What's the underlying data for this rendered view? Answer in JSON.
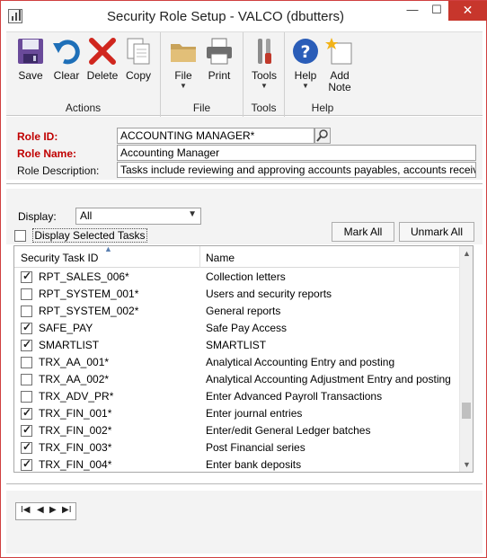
{
  "window": {
    "title": "Security Role Setup  -  VALCO (dbutters)",
    "controls": {
      "minimize": "—",
      "maximize": "☐",
      "close": "✕"
    }
  },
  "ribbon": {
    "groups": [
      {
        "label": "Actions",
        "buttons": [
          {
            "label": "Save",
            "icon": "save-icon"
          },
          {
            "label": "Clear",
            "icon": "clear-icon"
          },
          {
            "label": "Delete",
            "icon": "delete-icon"
          },
          {
            "label": "Copy",
            "icon": "copy-icon"
          }
        ]
      },
      {
        "label": "File",
        "buttons": [
          {
            "label": "File",
            "icon": "folder-icon",
            "dropdown": true
          },
          {
            "label": "Print",
            "icon": "print-icon"
          }
        ]
      },
      {
        "label": "Tools",
        "buttons": [
          {
            "label": "Tools",
            "icon": "tools-icon",
            "dropdown": true
          }
        ]
      },
      {
        "label": "Help",
        "buttons": [
          {
            "label": "Help",
            "icon": "help-icon",
            "dropdown": true
          },
          {
            "label": "Add\nNote",
            "icon": "add-note-icon"
          }
        ]
      }
    ]
  },
  "header": {
    "role_id_label": "Role ID:",
    "role_id_value": "ACCOUNTING MANAGER*",
    "role_name_label": "Role Name:",
    "role_name_value": "Accounting Manager",
    "role_desc_label": "Role Description:",
    "role_desc_value": "Tasks include reviewing and approving accounts payables, accounts receivables, p"
  },
  "filter": {
    "display_label": "Display:",
    "display_value": "All",
    "display_selected_label": "Display Selected Tasks",
    "mark_all": "Mark All",
    "unmark_all": "Unmark All"
  },
  "grid": {
    "col_id": "Security Task ID",
    "col_name": "Name",
    "rows": [
      {
        "id": "RPT_SALES_006*",
        "name": "Collection letters",
        "checked": true
      },
      {
        "id": "RPT_SYSTEM_001*",
        "name": "Users and security reports",
        "checked": false
      },
      {
        "id": "RPT_SYSTEM_002*",
        "name": "General reports",
        "checked": false
      },
      {
        "id": "SAFE_PAY",
        "name": "Safe Pay Access",
        "checked": true
      },
      {
        "id": "SMARTLIST",
        "name": "SMARTLIST",
        "checked": true
      },
      {
        "id": "TRX_AA_001*",
        "name": "Analytical Accounting Entry and posting",
        "checked": false
      },
      {
        "id": "TRX_AA_002*",
        "name": "Analytical Accounting Adjustment Entry and posting",
        "checked": false
      },
      {
        "id": "TRX_ADV_PR*",
        "name": "Enter Advanced Payroll Transactions",
        "checked": false
      },
      {
        "id": "TRX_FIN_001*",
        "name": "Enter journal entries",
        "checked": true
      },
      {
        "id": "TRX_FIN_002*",
        "name": "Enter/edit General Ledger batches",
        "checked": true
      },
      {
        "id": "TRX_FIN_003*",
        "name": "Post Financial series",
        "checked": true
      },
      {
        "id": "TRX_FIN_004*",
        "name": "Enter bank deposits",
        "checked": true
      }
    ]
  },
  "nav": {
    "first": "I◀",
    "prev": "◀",
    "next": "▶",
    "last": "▶I"
  }
}
